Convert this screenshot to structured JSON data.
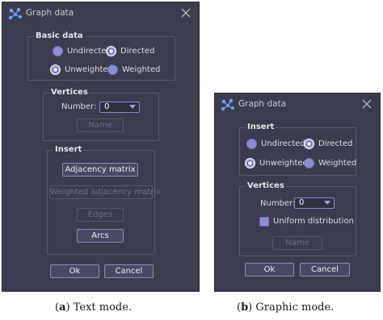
{
  "dialog_a": {
    "title": "Graph data",
    "basic": {
      "legend": "Basic data",
      "undirected": "Undirected",
      "directed": "Directed",
      "unweighted": "Unweighted",
      "weighted": "Weighted"
    },
    "vertices": {
      "legend": "Vertices",
      "number_label": "Number:",
      "number_value": "0",
      "name_button": "Name"
    },
    "insert": {
      "legend": "Insert",
      "adjacency": "Adjacency matrix",
      "weighted_adjacency": "Weighted adjacency matrix",
      "edges": "Edges",
      "arcs": "Arcs"
    },
    "ok": "Ok",
    "cancel": "Cancel",
    "caption_letter": "a",
    "caption_text": "Text mode."
  },
  "dialog_b": {
    "title": "Graph data",
    "insert": {
      "legend": "Insert",
      "undirected": "Undirected",
      "directed": "Directed",
      "unweighted": "Unweighted",
      "weighted": "Weighted"
    },
    "vertices": {
      "legend": "Vertices",
      "number_label": "Number:",
      "number_value": "0",
      "uniform": "Uniform distribution",
      "name_button": "Name"
    },
    "ok": "Ok",
    "cancel": "Cancel",
    "caption_letter": "b",
    "caption_text": "Graphic mode."
  },
  "icons": {
    "app": "graph-app-icon",
    "close": "close-icon",
    "dropdown": "chevron-down-icon"
  },
  "colors": {
    "dialog_bg": "#3b3d4e",
    "accent": "#8e8ed6",
    "border": "#585b6c"
  }
}
